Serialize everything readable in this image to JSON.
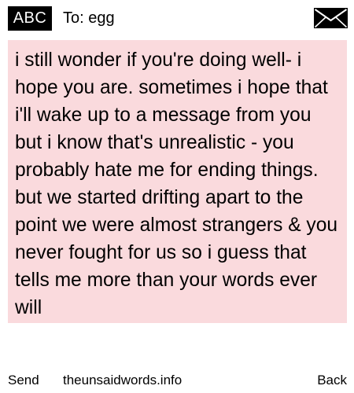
{
  "header": {
    "mode_label": "ABC",
    "recipient_label": "To: egg",
    "mail_icon": "envelope-icon"
  },
  "message": {
    "text": "i still wonder if you're doing well- i hope you are. sometimes i hope that i'll wake up to a message from you but i know that's unrealistic - you probably hate me for ending things. but we started drifting apart to the point we were almost strangers & you never fought for us so i guess that tells me more than your words ever will"
  },
  "footer": {
    "send_label": "Send",
    "site_label": "theunsaidwords.info",
    "back_label": "Back"
  },
  "colors": {
    "message_background": "#fadadd",
    "badge_background": "#000000",
    "badge_text": "#ffffff",
    "page_background": "#ffffff"
  }
}
